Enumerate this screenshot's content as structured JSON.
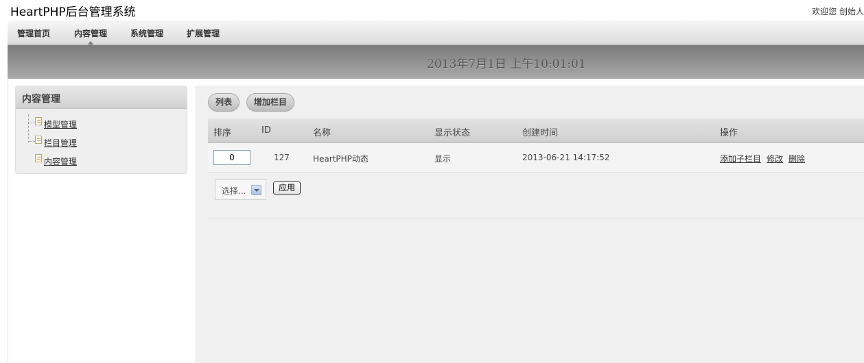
{
  "header": {
    "app_title": "HeartPHP后台管理系统",
    "welcome": "欢迎您 创始人"
  },
  "nav": {
    "items": [
      {
        "label": "管理首页"
      },
      {
        "label": "内容管理",
        "active": true
      },
      {
        "label": "系统管理"
      },
      {
        "label": "扩展管理"
      }
    ]
  },
  "datebar": {
    "datetime": "2013年7月1日 上午10:01:01"
  },
  "sidebar": {
    "title": "内容管理",
    "items": [
      {
        "label": "模型管理",
        "icon": "document-icon"
      },
      {
        "label": "栏目管理",
        "icon": "document-icon"
      },
      {
        "label": "内容管理",
        "icon": "document-icon"
      }
    ]
  },
  "toolbar": {
    "list_label": "列表",
    "add_label": "增加栏目"
  },
  "table": {
    "headers": [
      "排序",
      "ID",
      "名称",
      "显示状态",
      "创建时间",
      "操作"
    ],
    "rows": [
      {
        "order": "0",
        "id": "127",
        "name": "HeartPHP动态",
        "status": "显示",
        "created": "2013-06-21 14:17:52",
        "actions": [
          "添加子栏目",
          "修改",
          "删除"
        ]
      }
    ]
  },
  "bulk": {
    "select_value": "选择...",
    "apply_label": "应用"
  },
  "colors": {
    "nav_bg": "#dcdcdc",
    "datebar_bg": "#8f8f8f",
    "main_bg": "#f0f0f0"
  }
}
